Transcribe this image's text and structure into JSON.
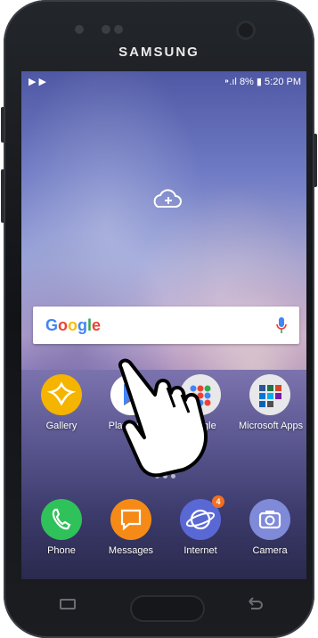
{
  "device": {
    "brand": "SAMSUNG"
  },
  "status_bar": {
    "left_icons": [
      "play-icon",
      "play-icon"
    ],
    "signal": "⁍.ıl",
    "battery_text": "8%",
    "time": "5:20 PM"
  },
  "search": {
    "logo": "Google",
    "mic_icon": "mic-icon"
  },
  "apps_row1": [
    {
      "label": "Gallery",
      "icon": "gallery-icon",
      "color": "#f4b400"
    },
    {
      "label": "Play Store",
      "icon": "play-store-icon",
      "color": "#ffffff"
    },
    {
      "label": "Google",
      "icon": "google-folder-icon",
      "color": "#e8e8ea"
    },
    {
      "label": "Microsoft Apps",
      "icon": "microsoft-folder-icon",
      "color": "#e8e8ea"
    }
  ],
  "apps_row2": [
    {
      "label": "Phone",
      "icon": "phone-icon",
      "color": "#2fc15a"
    },
    {
      "label": "Messages",
      "icon": "messages-icon",
      "color": "#f58b16"
    },
    {
      "label": "Internet",
      "icon": "internet-icon",
      "color": "#5a68d6",
      "badge": "4"
    },
    {
      "label": "Camera",
      "icon": "camera-icon",
      "color": "#7f8ad9"
    }
  ]
}
